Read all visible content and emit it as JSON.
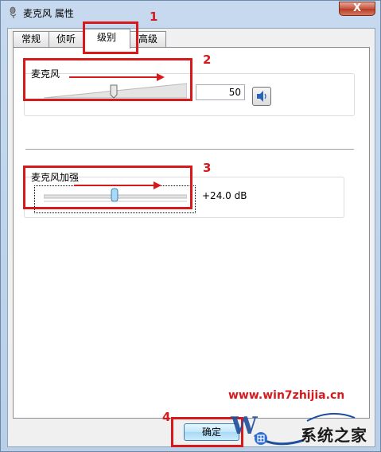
{
  "window": {
    "title": "麦克风 属性",
    "close_glyph": "X"
  },
  "tabs": [
    {
      "label": "常规",
      "active": false
    },
    {
      "label": "侦听",
      "active": false
    },
    {
      "label": "级别",
      "active": true
    },
    {
      "label": "高级",
      "active": false
    }
  ],
  "microphone": {
    "label": "麦克风",
    "value": "50",
    "level_percent": 50,
    "speaker_icon": "speaker-icon"
  },
  "boost": {
    "label": "麦克风加强",
    "value": "+24.0 dB",
    "level_percent": 50
  },
  "buttons": {
    "ok": "确定"
  },
  "annotations": {
    "n1": "1",
    "n2": "2",
    "n3": "3",
    "n4": "4",
    "color": "#d7191c"
  },
  "watermark": {
    "url": "www.win7zhijia.cn",
    "site_name": "系统之家"
  }
}
